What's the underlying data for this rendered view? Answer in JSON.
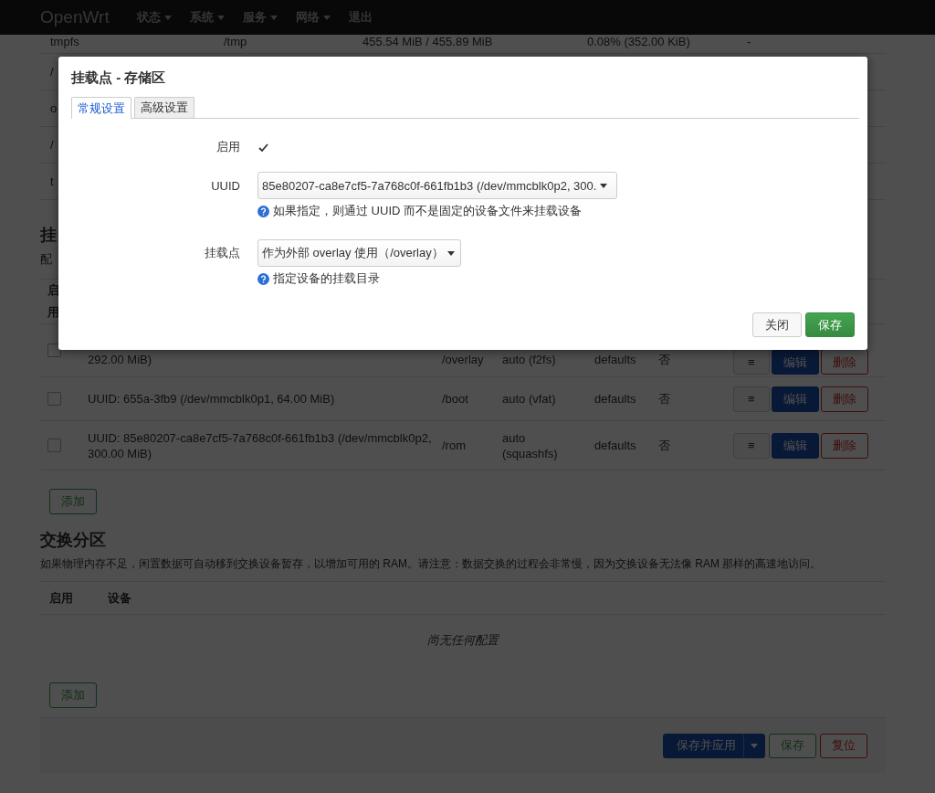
{
  "navbar": {
    "brand": "OpenWrt",
    "menu": [
      {
        "label": "状态",
        "dropdown": true
      },
      {
        "label": "系统",
        "dropdown": true
      },
      {
        "label": "服务",
        "dropdown": true
      },
      {
        "label": "网络",
        "dropdown": true
      },
      {
        "label": "退出",
        "dropdown": false
      }
    ]
  },
  "storage_table": {
    "rows": [
      [
        "tmpfs",
        "/tmp",
        "455.54 MiB / 455.89 MiB",
        "0.08% (352.00 KiB)",
        "-"
      ],
      [
        "/"
      ],
      [
        "o"
      ],
      [
        "/"
      ],
      [
        "t"
      ]
    ]
  },
  "mount_section": {
    "title": "挂",
    "description": "配",
    "header": "启用",
    "rows": [
      {
        "enabled": false,
        "device": "292.00 MiB)",
        "mount": "/overlay",
        "fs": "auto (f2fs)",
        "options": "defaults",
        "root": "否",
        "actions": [
          "≡",
          "编辑",
          "删除"
        ]
      },
      {
        "enabled": false,
        "device": "UUID: 655a-3fb9 (/dev/mmcblk0p1, 64.00 MiB)",
        "mount": "/boot",
        "fs": "auto (vfat)",
        "options": "defaults",
        "root": "否",
        "actions": [
          "≡",
          "编辑",
          "删除"
        ]
      },
      {
        "enabled": false,
        "device": "UUID: 85e80207-ca8e7cf5-7a768c0f-661fb1b3 (/dev/mmcblk0p2, 300.00 MiB)",
        "mount": "/rom",
        "fs": "auto (squashfs)",
        "options": "defaults",
        "root": "否",
        "actions": [
          "≡",
          "编辑",
          "删除"
        ]
      }
    ],
    "add_button": "添加"
  },
  "swap_section": {
    "title": "交换分区",
    "description": "如果物理内存不足，闲置数据可自动移到交换设备暂存，以增加可用的 RAM。请注意：数据交换的过程会非常慢，因为交换设备无法像 RAM 那样的高速地访问。",
    "columns": [
      "启用",
      "设备"
    ],
    "empty_text": "尚无任何配置",
    "add_button": "添加"
  },
  "footer": {
    "buttons": [
      {
        "label": "保存并应用",
        "kind": "apply"
      },
      {
        "label": "保存",
        "kind": "save"
      },
      {
        "label": "复位",
        "kind": "reset"
      }
    ]
  },
  "modal": {
    "title": "挂载点 - 存储区",
    "tabs": [
      {
        "label": "常规设置",
        "selected": true
      },
      {
        "label": "高级设置",
        "selected": false
      }
    ],
    "fields": [
      {
        "kind": "checkbox",
        "label": "启用",
        "checked": true
      },
      {
        "kind": "select",
        "label": "UUID",
        "value": "85e80207-ca8e7cf5-7a768c0f-661fb1b3 (/dev/mmcblk0p2, 300.",
        "help": "如果指定，则通过 UUID 而不是固定的设备文件来挂载设备"
      },
      {
        "kind": "select",
        "label": "挂载点",
        "value": "作为外部 overlay 使用（/overlay）",
        "help": "指定设备的挂载目录"
      }
    ],
    "buttons": [
      {
        "label": "关闭",
        "kind": "close"
      },
      {
        "label": "保存",
        "kind": "save"
      }
    ]
  }
}
